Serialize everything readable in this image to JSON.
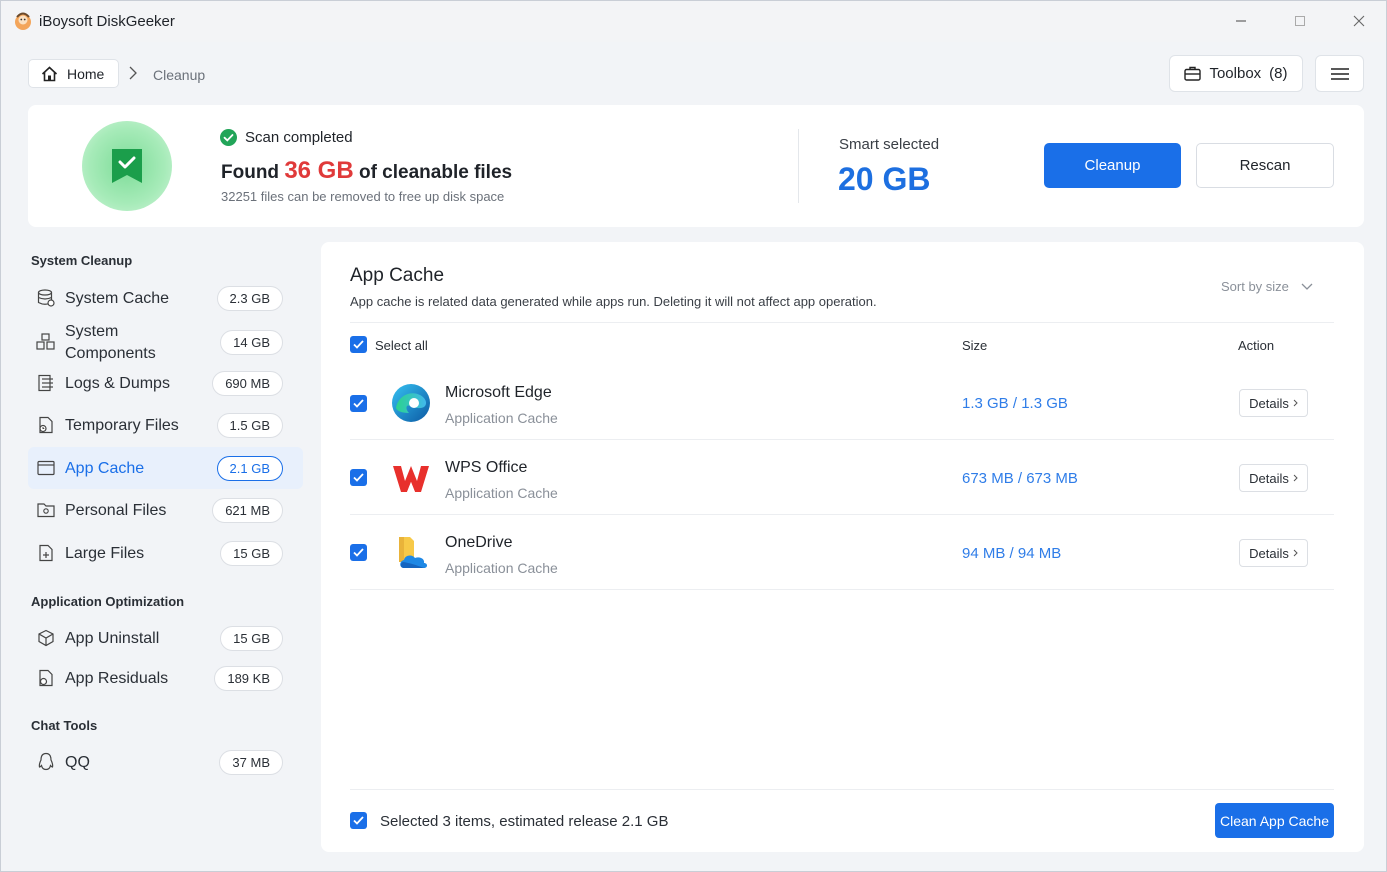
{
  "window": {
    "title": "iBoysoft DiskGeeker"
  },
  "breadcrumb": {
    "home": "Home",
    "current": "Cleanup"
  },
  "toolbar": {
    "toolbox_label": "Toolbox",
    "toolbox_count": "(8)"
  },
  "summary": {
    "status": "Scan completed",
    "found_prefix": "Found",
    "found_amount": "36 GB",
    "found_suffix": "of cleanable files",
    "found_sub": "32251 files can be removed to free up disk space",
    "smart_label": "Smart selected",
    "smart_value": "20 GB",
    "cleanup_label": "Cleanup",
    "rescan_label": "Rescan"
  },
  "sidebar": {
    "sections": [
      {
        "title": "System Cleanup"
      },
      {
        "title": "Application Optimization"
      },
      {
        "title": "Chat Tools"
      }
    ],
    "items": [
      {
        "label": "System Cache",
        "size": "2.3 GB"
      },
      {
        "label": "System Components",
        "size": "14 GB"
      },
      {
        "label": "Logs & Dumps",
        "size": "690 MB"
      },
      {
        "label": "Temporary Files",
        "size": "1.5 GB"
      },
      {
        "label": "App Cache",
        "size": "2.1 GB"
      },
      {
        "label": "Personal Files",
        "size": "621 MB"
      },
      {
        "label": "Large Files",
        "size": "15 GB"
      },
      {
        "label": "App Uninstall",
        "size": "15 GB"
      },
      {
        "label": "App Residuals",
        "size": "189 KB"
      },
      {
        "label": "QQ",
        "size": "37 MB"
      }
    ],
    "system_components_line1": "System",
    "system_components_line2": "Components"
  },
  "panel": {
    "title": "App Cache",
    "description": "App cache is related data generated while apps run. Deleting it will not affect app operation.",
    "sort_label": "Sort by size",
    "select_all": "Select all",
    "col_size": "Size",
    "col_action": "Action",
    "rows": [
      {
        "name": "Microsoft Edge",
        "type": "Application Cache",
        "size": "1.3 GB / 1.3 GB",
        "action": "Details"
      },
      {
        "name": "WPS Office",
        "type": "Application Cache",
        "size": "673 MB / 673 MB",
        "action": "Details"
      },
      {
        "name": "OneDrive",
        "type": "Application Cache",
        "size": "94 MB / 94 MB",
        "action": "Details"
      }
    ],
    "footer_text": "Selected 3 items, estimated release 2.1 GB",
    "clean_button": "Clean App Cache"
  },
  "colors": {
    "accent": "#1a6fe8",
    "found_red": "#e03a3a",
    "size_blue": "#2f7de8"
  }
}
